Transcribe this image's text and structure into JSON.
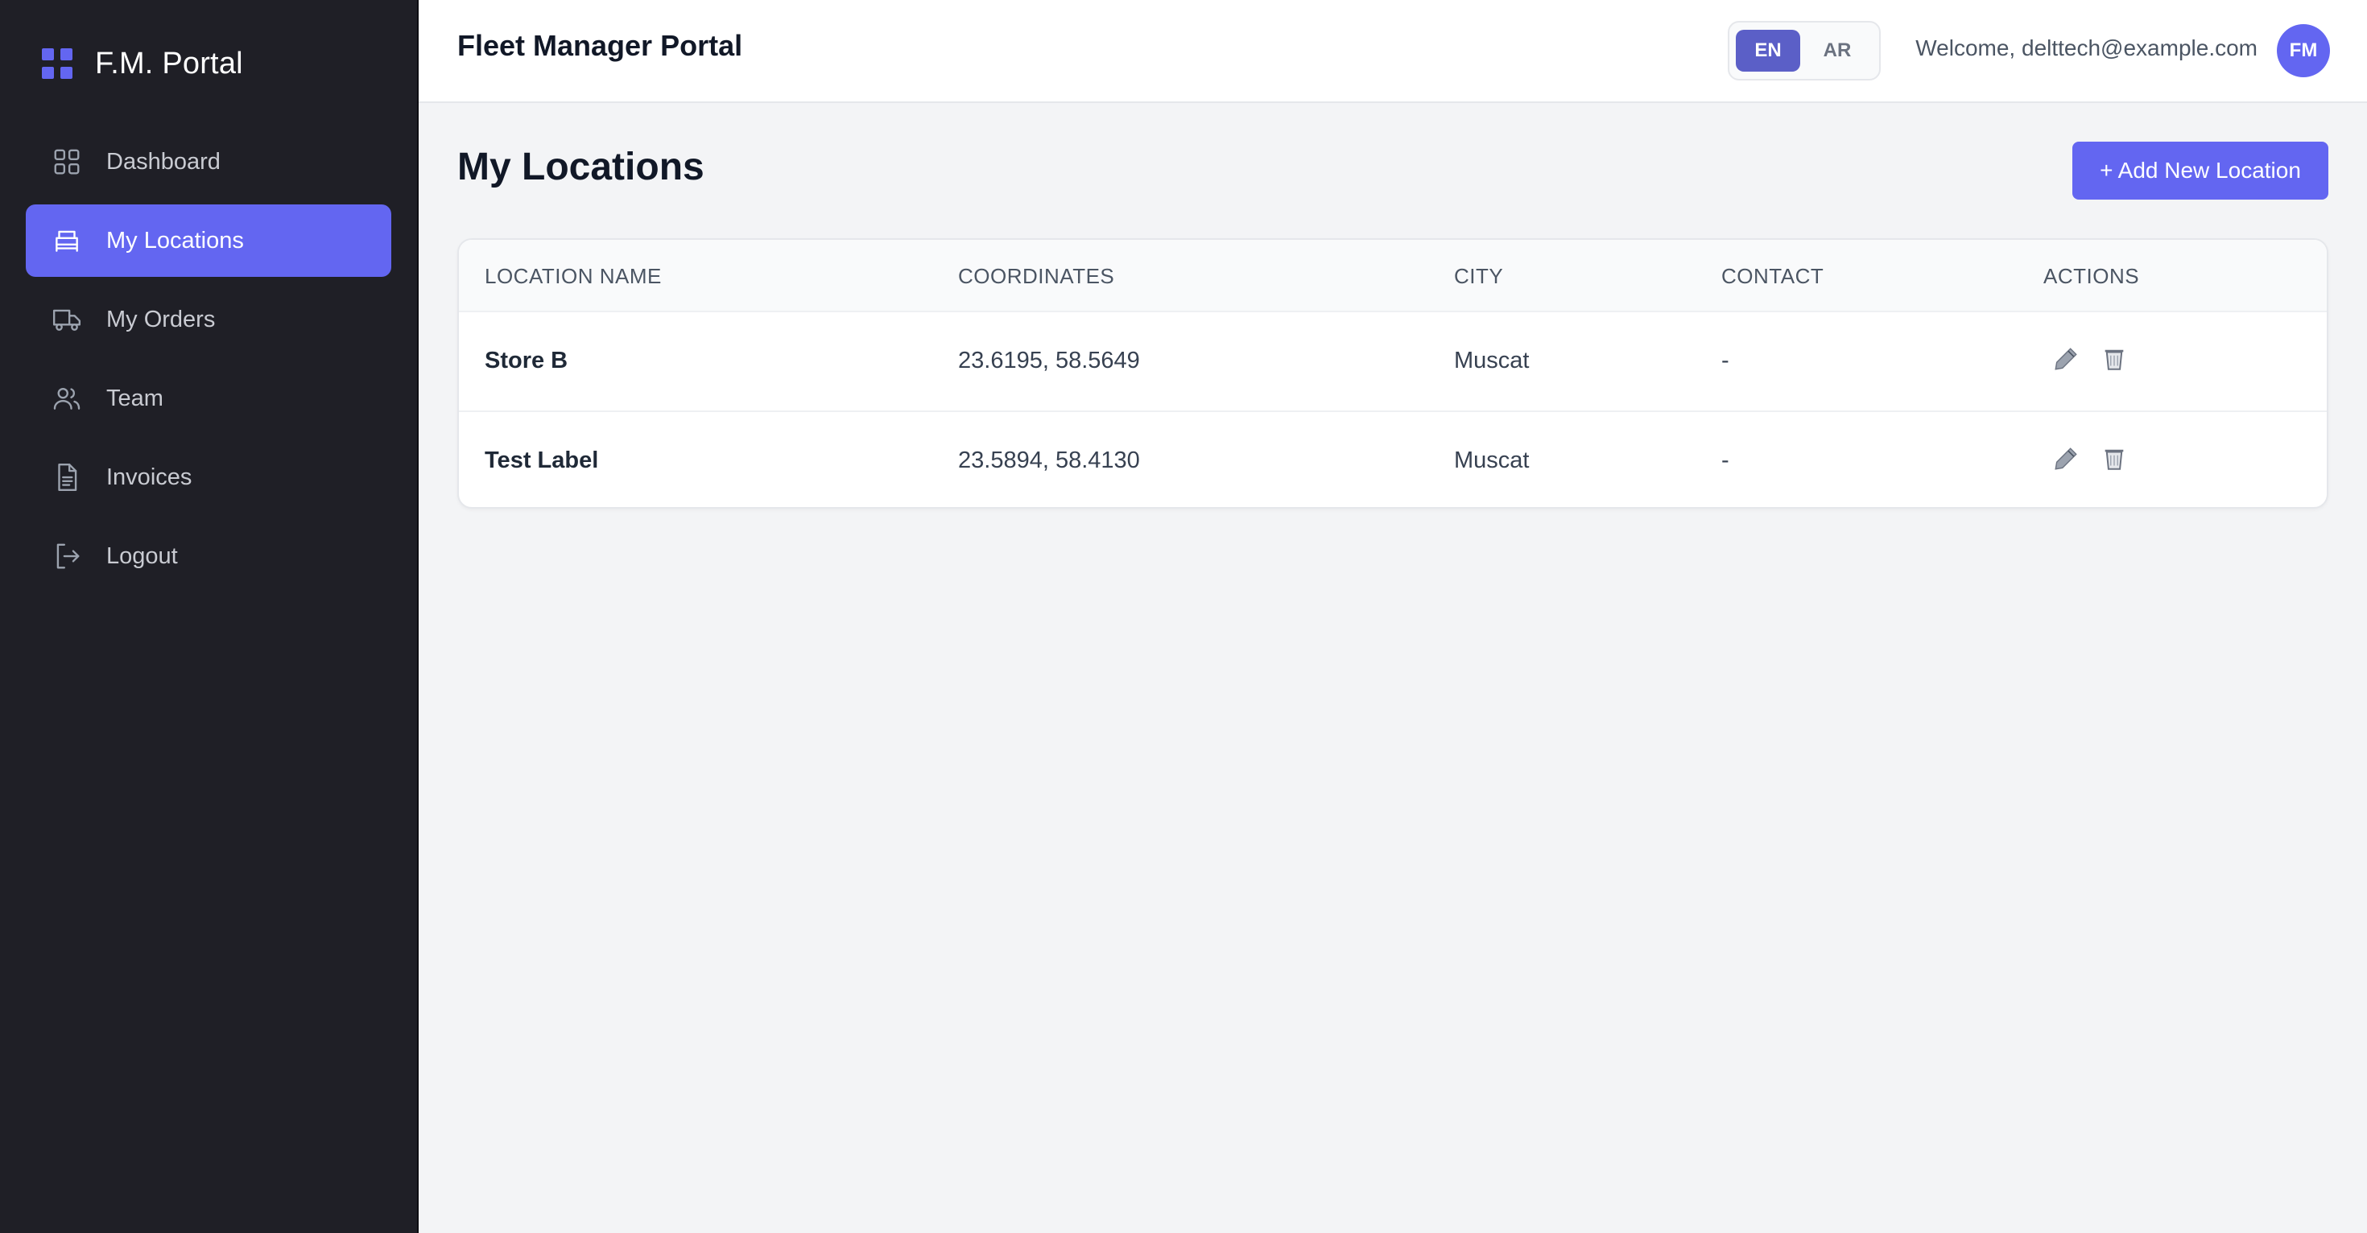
{
  "sidebar": {
    "brand": "F.M. Portal",
    "items": [
      {
        "label": "Dashboard",
        "icon": "dashboard-grid-icon",
        "active": false
      },
      {
        "label": "My Locations",
        "icon": "store-icon",
        "active": true
      },
      {
        "label": "My Orders",
        "icon": "truck-icon",
        "active": false
      },
      {
        "label": "Team",
        "icon": "users-icon",
        "active": false
      },
      {
        "label": "Invoices",
        "icon": "document-icon",
        "active": false
      },
      {
        "label": "Logout",
        "icon": "logout-icon",
        "active": false
      }
    ]
  },
  "header": {
    "title": "Fleet Manager Portal",
    "languages": [
      {
        "label": "EN",
        "active": true
      },
      {
        "label": "AR",
        "active": false
      }
    ],
    "welcome": "Welcome, delttech@example.com",
    "avatar_initials": "FM"
  },
  "main": {
    "page_title": "My Locations",
    "add_button": "+ Add New Location",
    "table": {
      "columns": [
        "LOCATION NAME",
        "COORDINATES",
        "CITY",
        "CONTACT",
        "ACTIONS"
      ],
      "rows": [
        {
          "name": "Store B",
          "coordinates": "23.6195, 58.5649",
          "city": "Muscat",
          "contact": "-"
        },
        {
          "name": "Test Label",
          "coordinates": "23.5894, 58.4130",
          "city": "Muscat",
          "contact": "-"
        }
      ]
    }
  },
  "colors": {
    "accent": "#6366f1",
    "sidebar_bg": "#1f1f26",
    "page_bg": "#f3f4f6"
  }
}
